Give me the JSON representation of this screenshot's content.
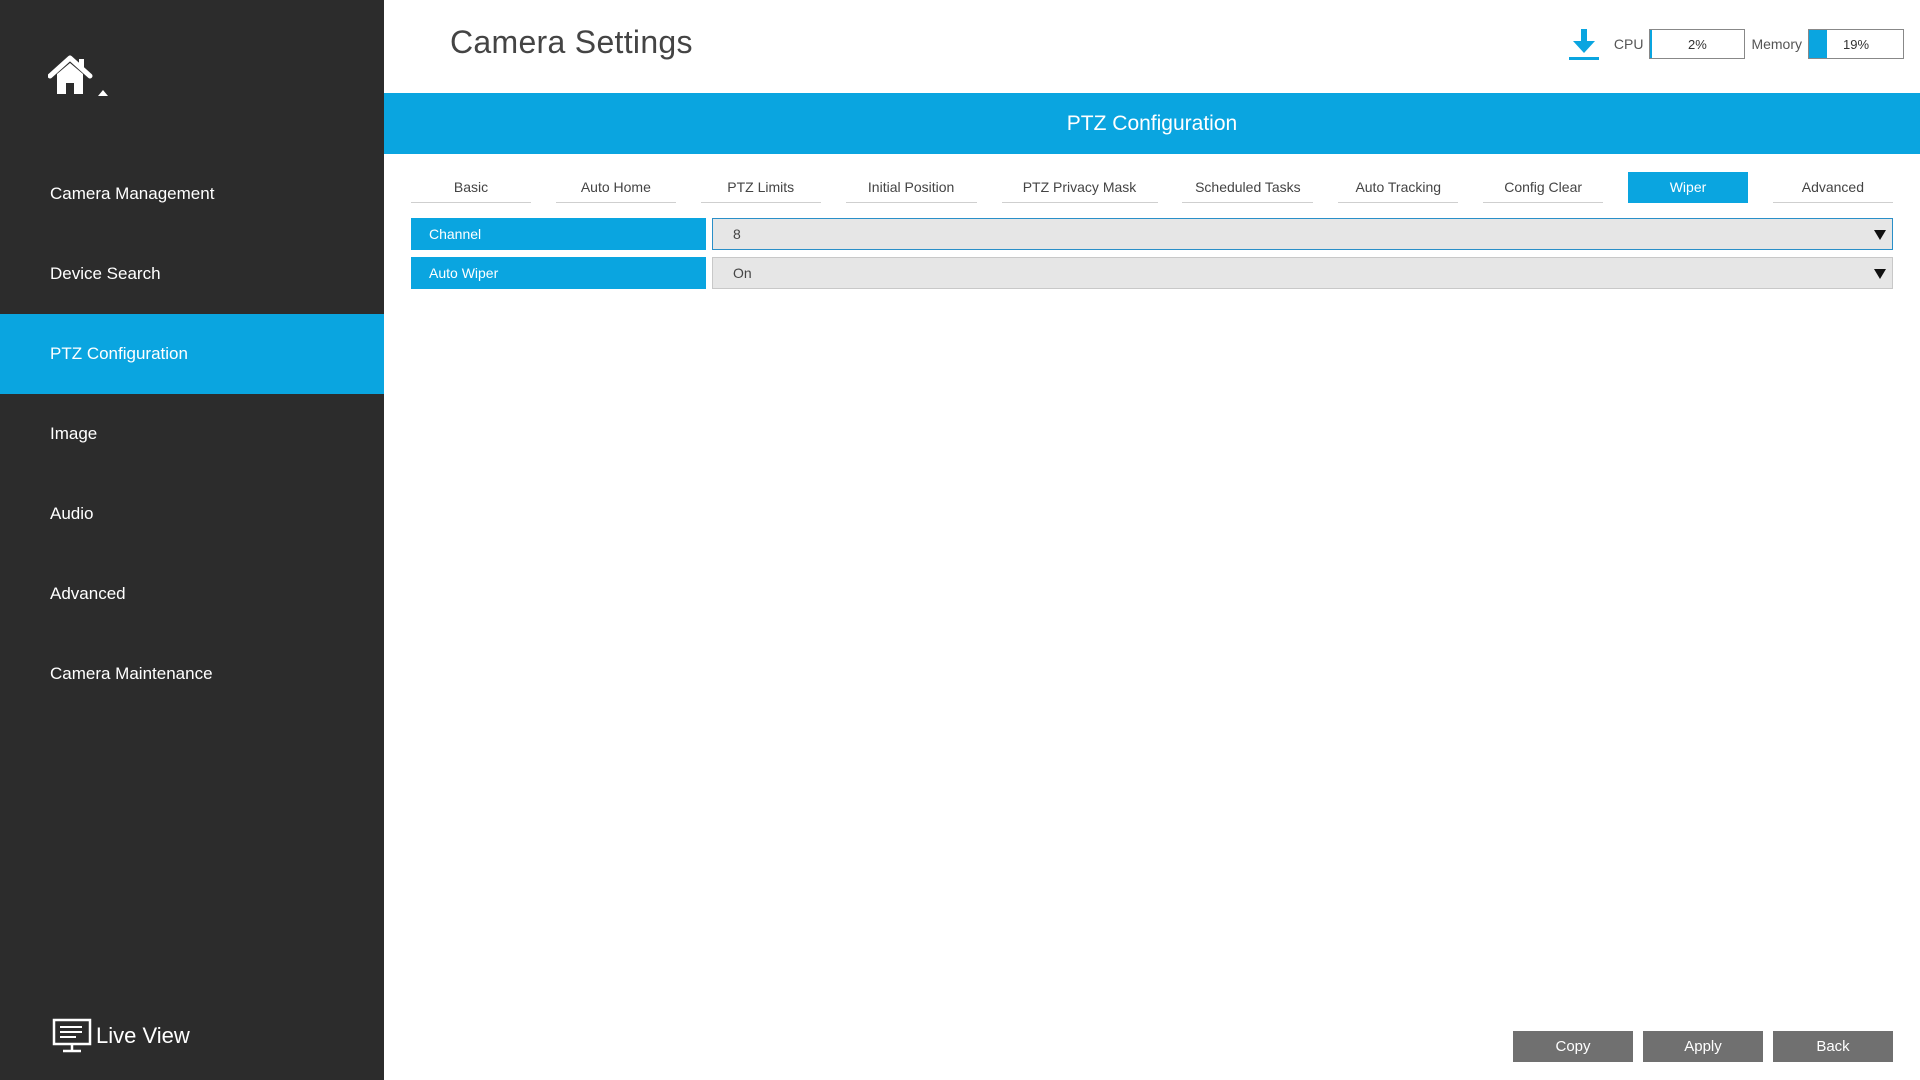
{
  "header": {
    "title": "Camera Settings",
    "cpu": {
      "label": "CPU",
      "value_text": "2%",
      "value": 2
    },
    "memory": {
      "label": "Memory",
      "value_text": "19%",
      "value": 19
    },
    "download_icon": "download-icon"
  },
  "sidebar": {
    "home_icon": "home-icon",
    "items": [
      {
        "label": "Camera Management",
        "active": false
      },
      {
        "label": "Device Search",
        "active": false
      },
      {
        "label": "PTZ Configuration",
        "active": true
      },
      {
        "label": "Image",
        "active": false
      },
      {
        "label": "Audio",
        "active": false
      },
      {
        "label": "Advanced",
        "active": false
      },
      {
        "label": "Camera Maintenance",
        "active": false
      }
    ],
    "live_view": {
      "label": "Live View",
      "icon": "monitor-icon"
    }
  },
  "banner": {
    "title": "PTZ Configuration"
  },
  "tabs": [
    {
      "label": "Basic",
      "active": false
    },
    {
      "label": "Auto Home",
      "active": false
    },
    {
      "label": "PTZ Limits",
      "active": false
    },
    {
      "label": "Initial Position",
      "active": false
    },
    {
      "label": "PTZ Privacy Mask",
      "active": false
    },
    {
      "label": "Scheduled Tasks",
      "active": false
    },
    {
      "label": "Auto Tracking",
      "active": false
    },
    {
      "label": "Config Clear",
      "active": false
    },
    {
      "label": "Wiper",
      "active": true
    },
    {
      "label": "Advanced",
      "active": false
    }
  ],
  "form": {
    "channel": {
      "label": "Channel",
      "value": "8"
    },
    "auto_wiper": {
      "label": "Auto Wiper",
      "value": "On"
    }
  },
  "footer": {
    "copy_label": "Copy",
    "apply_label": "Apply",
    "back_label": "Back"
  },
  "colors": {
    "accent": "#0aa5e0",
    "sidebar_bg": "#2c2c2c",
    "button_bg": "#707070"
  }
}
